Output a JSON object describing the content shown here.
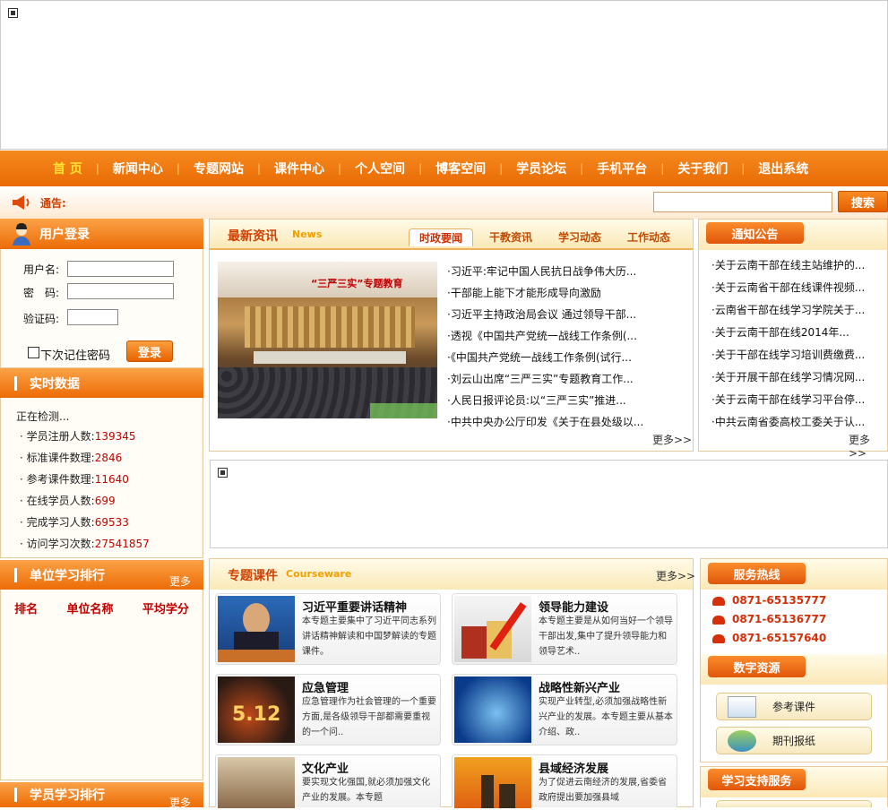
{
  "nav": [
    "首 页",
    "新闻中心",
    "专题网站",
    "课件中心",
    "个人空间",
    "博客空间",
    "学员论坛",
    "手机平台",
    "关于我们",
    "退出系统"
  ],
  "notice": {
    "label": "通告:"
  },
  "search": {
    "button": "搜索",
    "value": ""
  },
  "login": {
    "title": "用户登录",
    "username_label": "用户名:",
    "password_label": "密　码:",
    "captcha_label": "验证码:",
    "remember_label": "下次记住密码",
    "login_button": "登录"
  },
  "realtime": {
    "title": "实时数据",
    "status": "正在检测...",
    "items": [
      {
        "label": "学员注册人数:",
        "value": "139345"
      },
      {
        "label": "标准课件数理:",
        "value": "2846"
      },
      {
        "label": "参考课件数理:",
        "value": "11640"
      },
      {
        "label": "在线学员人数:",
        "value": "699"
      },
      {
        "label": "完成学习人数:",
        "value": "69533"
      },
      {
        "label": "访问学习次数:",
        "value": "27541857"
      }
    ]
  },
  "unit_rank": {
    "title": "单位学习排行",
    "more": "更多",
    "cols": [
      "排名",
      "单位名称",
      "平均学分"
    ]
  },
  "student_rank": {
    "title": "学员学习排行",
    "more": "更多"
  },
  "news": {
    "title": "最新资讯",
    "subtitle": "News",
    "tabs": [
      "时政要闻",
      "干教资讯",
      "学习动态",
      "工作动态"
    ],
    "items": [
      "·习近平:牢记中国人民抗日战争伟大历...",
      "·干部能上能下才能形成导向激励",
      "·习近平主持政治局会议 通过领导干部...",
      "·透视《中国共产党统一战线工作条例(...",
      "·《中国共产党统一战线工作条例(试行...",
      "·刘云山出席“三严三实”专题教育工作...",
      "·人民日报评论员:以“三严三实”推进...",
      "·中共中央办公厅印发《关于在县处级以..."
    ],
    "more": "更多>>",
    "banner_text": "“三严三实”专题教育"
  },
  "announce": {
    "title": "通知公告",
    "items": [
      "·关于云南干部在线主站维护的...",
      "·关于云南省干部在线课件视频...",
      "·云南省干部在线学习学院关于...",
      "·关于云南干部在线2014年...",
      "·关于干部在线学习培训费缴费...",
      "·关于开展干部在线学习情况网...",
      "·关于云南干部在线学习平台停...",
      "·中共云南省委高校工委关于认..."
    ],
    "more": "更多>>"
  },
  "courses": {
    "title": "专题课件",
    "subtitle": "Courseware",
    "more": "更多>>",
    "cards": [
      {
        "title": "习近平重要讲话精神",
        "desc": "本专题主要集中了习近平同志系列讲话精神解读和中国梦解读的专题课件。"
      },
      {
        "title": "领导能力建设",
        "desc": "本专题主要是从如何当好一个领导干部出发,集中了提升领导能力和领导艺术.."
      },
      {
        "title": "应急管理",
        "desc": "应急管理作为社会管理的一个重要方面,是各级领导干部都需要重视的一个问.."
      },
      {
        "title": "战略性新兴产业",
        "desc": "实现产业转型,必须加强战略性新兴产业的发展。本专题主要从基本介绍、政.."
      },
      {
        "title": "文化产业",
        "desc": "要实现文化强国,就必须加强文化产业的发展。本专题"
      },
      {
        "title": "县域经济发展",
        "desc": "为了促进云南经济的发展,省委省政府提出要加强县域"
      }
    ]
  },
  "hotline": {
    "title": "服务热线",
    "phones": [
      "0871-65135777",
      "0871-65136777",
      "0871-65157640"
    ]
  },
  "digital": {
    "title": "数字资源",
    "items": [
      "参考课件",
      "期刊报纸"
    ]
  },
  "support": {
    "title": "学习支持服务"
  },
  "colors": {
    "accent": "#ec6c06",
    "dark_red": "#c00000",
    "nav_highlight": "#ffe033"
  }
}
